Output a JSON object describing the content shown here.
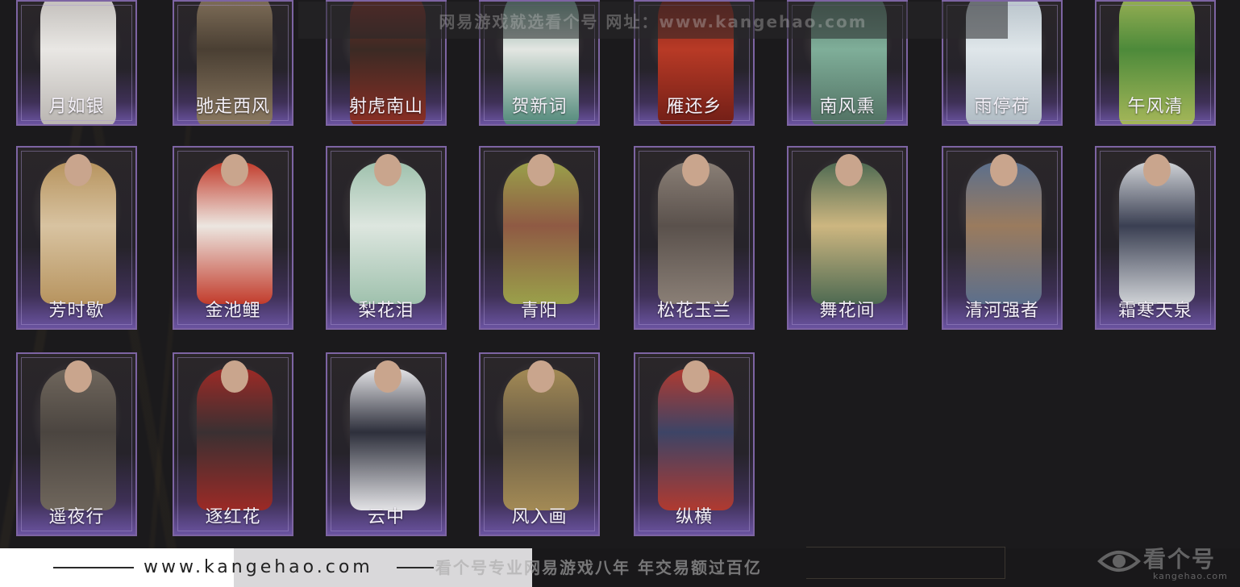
{
  "watermark_top": "网易游戏就选看个号  网址：www.kangehao.com",
  "rows": [
    [
      {
        "name": "月如银",
        "colors": [
          "#e9e7e4",
          "#b8b4b0"
        ]
      },
      {
        "name": "驰走西风",
        "colors": [
          "#4a3f33",
          "#8c7a62"
        ]
      },
      {
        "name": "射虎南山",
        "colors": [
          "#3b2a24",
          "#8e2e24"
        ]
      },
      {
        "name": "贺新词",
        "colors": [
          "#e3e6e2",
          "#4c8676"
        ]
      },
      {
        "name": "雁还乡",
        "colors": [
          "#b83a26",
          "#6e1d16"
        ]
      },
      {
        "name": "南风熏",
        "colors": [
          "#7fae99",
          "#4f6e60"
        ]
      },
      {
        "name": "雨停荷",
        "colors": [
          "#dfe6ea",
          "#aebac2"
        ]
      },
      {
        "name": "午风清",
        "colors": [
          "#4d8a3a",
          "#a8b85a"
        ]
      }
    ],
    [
      {
        "name": "芳时歇",
        "colors": [
          "#d8c3a1",
          "#b7945f"
        ]
      },
      {
        "name": "金池鲤",
        "colors": [
          "#ece6e0",
          "#c23c2c"
        ]
      },
      {
        "name": "梨花泪",
        "colors": [
          "#dde6df",
          "#9fc1ad"
        ]
      },
      {
        "name": "青阳",
        "colors": [
          "#8f5a44",
          "#9aa04a"
        ]
      },
      {
        "name": "松花玉兰",
        "colors": [
          "#5a514c",
          "#8a7f76"
        ]
      },
      {
        "name": "舞花间",
        "colors": [
          "#cdb680",
          "#4e6a52"
        ]
      },
      {
        "name": "清河强者",
        "colors": [
          "#9a7b5e",
          "#5c6f8c"
        ]
      },
      {
        "name": "霜寒天泉",
        "colors": [
          "#3a3f52",
          "#cfd2d6"
        ]
      }
    ],
    [
      {
        "name": "遥夜行",
        "colors": [
          "#4b4540",
          "#6f665c"
        ]
      },
      {
        "name": "逐红花",
        "colors": [
          "#3a3032",
          "#9c2a26"
        ]
      },
      {
        "name": "云中",
        "colors": [
          "#2d2f3b",
          "#e3e3e6"
        ]
      },
      {
        "name": "风入画",
        "colors": [
          "#6a5d46",
          "#a38a55"
        ]
      },
      {
        "name": "纵横",
        "colors": [
          "#3d4466",
          "#b03a30"
        ]
      }
    ]
  ],
  "footer": {
    "url": "www.kangehao.com",
    "slogan": "看个号专业网易游戏八年  年交易额过百亿",
    "logo_text": "看个号",
    "logo_sub": "kangehao.com"
  }
}
